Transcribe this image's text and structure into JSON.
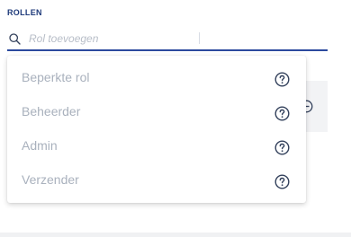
{
  "section": {
    "title": "ROLLEN"
  },
  "search": {
    "placeholder": "Rol toevoegen",
    "value": "",
    "icon": "search-icon"
  },
  "dropdown": {
    "options": [
      {
        "label": "Beperkte rol",
        "icon": "help-circle-icon"
      },
      {
        "label": "Beheerder",
        "icon": "help-circle-icon"
      },
      {
        "label": "Admin",
        "icon": "help-circle-icon"
      },
      {
        "label": "Verzender",
        "icon": "help-circle-icon"
      }
    ]
  },
  "colors": {
    "accent": "#2c4a9e",
    "title": "#1e3a7a",
    "option_text": "#a9b1bd",
    "icon": "#33415c"
  }
}
